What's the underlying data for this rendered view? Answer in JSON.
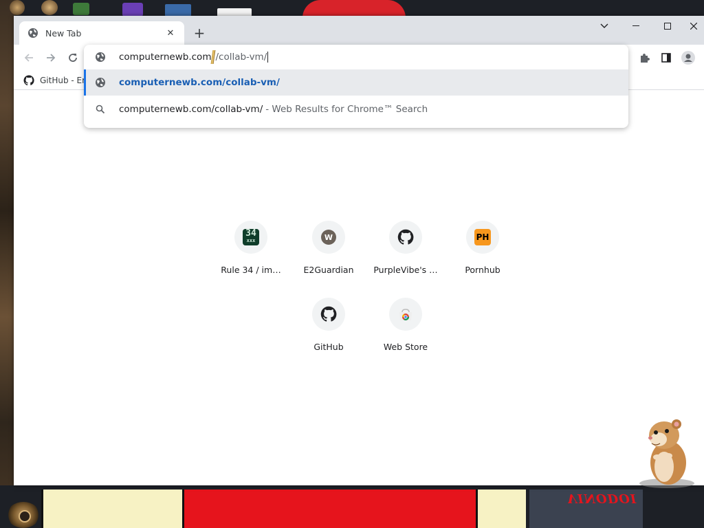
{
  "window": {
    "tab_title": "New Tab",
    "new_tab_symbol": "+",
    "controls": {
      "menu": "⌄",
      "minimize": "—",
      "maximize": "☐",
      "close": "✕"
    }
  },
  "toolbar": {
    "back": "←",
    "forward": "→",
    "reload": "↻"
  },
  "bookmarks": [
    {
      "label": "GitHub - Er",
      "icon": "github-icon"
    }
  ],
  "omnibox": {
    "typed_prefix": "computernewb.co",
    "typed_mid": "m",
    "typed_suffix": "/collab-vm/",
    "suggestions": [
      {
        "type": "url",
        "text": "computernewb.com/collab-vm/",
        "icon": "globe-icon",
        "active": true
      },
      {
        "type": "search",
        "text": "computernewb.com/collab-vm/",
        "desc": "- Web Results for Chrome™ Search",
        "icon": "search-icon",
        "active": false
      }
    ]
  },
  "shortcuts": [
    {
      "label": "Rule 34 / im…",
      "icon_text": "34",
      "icon": "rule34-favicon"
    },
    {
      "label": "E2Guardian",
      "icon_text": "W",
      "icon": "e2guardian-favicon"
    },
    {
      "label": "PurpleVibe's …",
      "icon_text": "",
      "icon": "github-icon"
    },
    {
      "label": "Pornhub",
      "icon_text": "PH",
      "icon": "pornhub-favicon"
    },
    {
      "label": "GitHub",
      "icon_text": "",
      "icon": "github-icon"
    },
    {
      "label": "Web Store",
      "icon_text": "",
      "icon": "chrome-web-store-icon"
    }
  ],
  "desktop": {
    "banner_text": "VINODOI"
  },
  "colors": {
    "titlebar": "#dee1e6",
    "accent": "#1a73e8",
    "link": "#1a5fb4",
    "tile_bg": "#f1f3f4"
  }
}
